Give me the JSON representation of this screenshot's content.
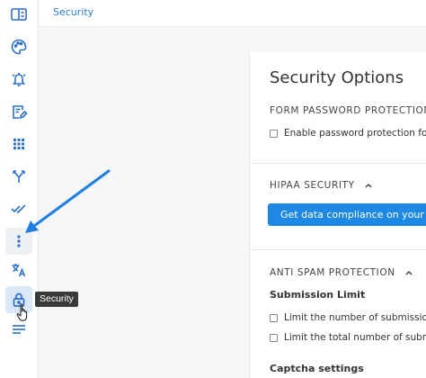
{
  "header": {
    "breadcrumb": "Security"
  },
  "sidebar": {
    "items": [
      {
        "icon": "form-layout-icon"
      },
      {
        "icon": "palette-icon"
      },
      {
        "icon": "alarm-icon"
      },
      {
        "icon": "edit-document-icon"
      },
      {
        "icon": "grid-icon"
      },
      {
        "icon": "branch-icon"
      },
      {
        "icon": "double-check-icon"
      },
      {
        "icon": "more-vertical-icon"
      },
      {
        "icon": "translate-icon"
      },
      {
        "icon": "lock-icon"
      },
      {
        "icon": "menu-lines-icon"
      }
    ],
    "tooltip": "Security"
  },
  "panel": {
    "title": "Security Options",
    "form_password": {
      "heading": "FORM PASSWORD PROTECTION",
      "checkbox_label": "Enable password protection for t"
    },
    "hipaa": {
      "heading": "HIPAA SECURITY",
      "button_label": "Get data compliance on your form"
    },
    "anti_spam": {
      "heading": "ANTI SPAM PROTECTION",
      "submission_limit": "Submission Limit",
      "limit_number_label": "Limit the number of submissions",
      "limit_total_label": "Limit the total number of submiss"
    },
    "captcha": {
      "heading": "Captcha settings"
    }
  },
  "colors": {
    "accent": "#1e88e5",
    "link": "#2d7ed6",
    "icon": "#2a6fc9",
    "annotation_arrow": "#1e7fe0"
  }
}
